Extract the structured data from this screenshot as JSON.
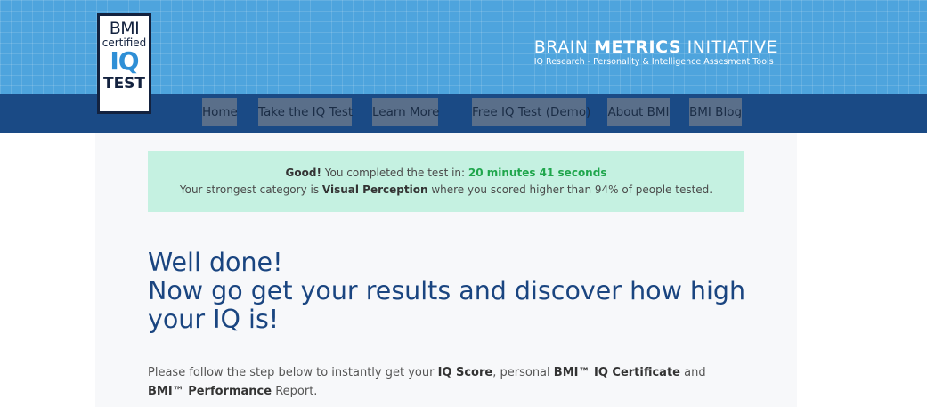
{
  "logo": {
    "line1": "BMI",
    "line2": "certified",
    "line3": "IQ",
    "line4": "TEST"
  },
  "brand": {
    "name_part1": "BRAIN ",
    "name_part2": "METRICS",
    "name_part3": " INITIATIVE",
    "tagline": "IQ Research - Personality & Intelligence Assesment Tools"
  },
  "nav": {
    "items": [
      {
        "label": "Home"
      },
      {
        "label": "Take the IQ Test"
      },
      {
        "label": "Learn More"
      },
      {
        "label": "Free IQ Test (Demo)"
      },
      {
        "label": "About BMI"
      },
      {
        "label": "BMI Blog"
      }
    ]
  },
  "notice": {
    "good": "Good!",
    "completed_text": " You completed the test in: ",
    "time": "20 minutes 41 seconds",
    "strongest_prefix": "Your strongest category is ",
    "category": "Visual Perception",
    "strongest_suffix": " where you scored higher than 94% of people tested."
  },
  "headline": {
    "line1": "Well done!",
    "line2": "Now go get your results and discover how high your IQ is!"
  },
  "intro": {
    "t1": "Please follow the step below to instantly get your ",
    "b1": "IQ Score",
    "t2": ", personal ",
    "b2": "BMI™ IQ Certificate",
    "t3": " and ",
    "b3": "BMI™ Performance",
    "t4": " Report."
  },
  "colors": {
    "header_bg": "#4ea4dd",
    "nav_bg": "#1a4a85",
    "notice_bg": "#c5f1e1",
    "headline": "#1a4580",
    "time_green": "#1fa64c"
  }
}
